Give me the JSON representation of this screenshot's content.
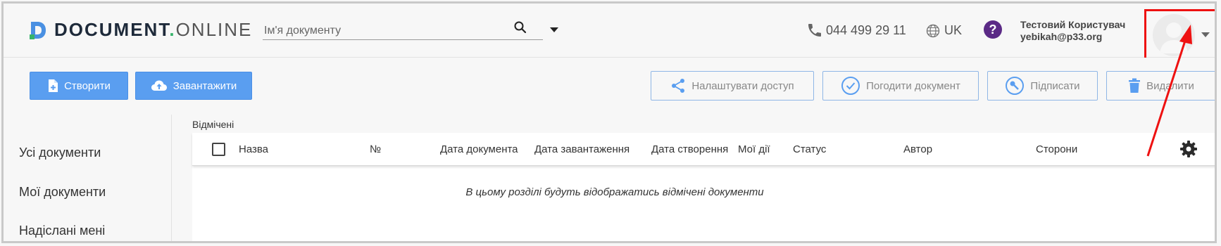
{
  "brand": {
    "name_bold": "DOCUMENT",
    "dot": ".",
    "name_light": "ONLINE"
  },
  "search": {
    "placeholder": "Ім'я документу",
    "value": ""
  },
  "header": {
    "phone": "044 499 29 11",
    "language": "UK",
    "help_label": "?",
    "user_name": "Тестовий Користувач",
    "user_email": "yebikah@p33.org"
  },
  "toolbar": {
    "create_label": "Створити",
    "upload_label": "Завантажити",
    "access_label": "Налаштувати доступ",
    "approve_label": "Погодити документ",
    "sign_label": "Підписати",
    "delete_label": "Видалити"
  },
  "sidebar": {
    "items": [
      {
        "label": "Усі документи"
      },
      {
        "label": "Мої документи"
      },
      {
        "label": "Надіслані мені"
      }
    ]
  },
  "main": {
    "section_title": "Відмічені",
    "columns": [
      "Назва",
      "№",
      "Дата документа",
      "Дата завантаження",
      "Дата створення",
      "Мої дії",
      "Статус",
      "Автор",
      "Сторони"
    ],
    "empty_message": "В цьому розділі будуть відображатись відмічені документи"
  },
  "colors": {
    "primary_button": "#5a9ef0",
    "highlight_red": "#ee1111",
    "help_purple": "#5b2a86",
    "brand_green": "#36b36a"
  },
  "icons": [
    "logo-icon",
    "search-icon",
    "chevron-down-icon",
    "phone-icon",
    "globe-icon",
    "help-icon",
    "avatar",
    "file-plus-icon",
    "cloud-upload-icon",
    "share-icon",
    "check-circle-icon",
    "key-icon",
    "trash-icon",
    "gear-icon"
  ]
}
